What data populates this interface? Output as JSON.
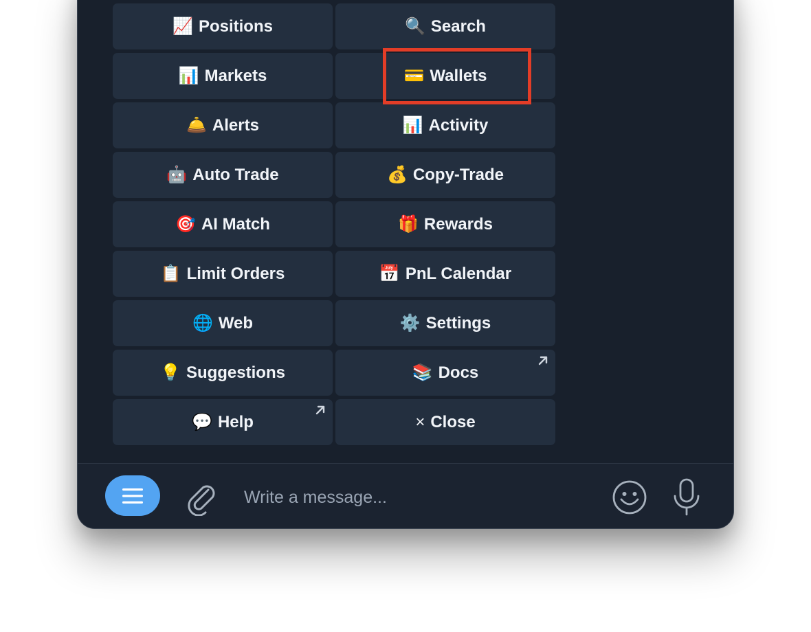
{
  "keyboard": {
    "buttons": [
      {
        "emoji": "📈",
        "label": "Positions"
      },
      {
        "emoji": "🔍",
        "label": "Search"
      },
      {
        "emoji": "📊",
        "label": "Markets"
      },
      {
        "emoji": "💳",
        "label": "Wallets"
      },
      {
        "emoji": "🛎️",
        "label": "Alerts"
      },
      {
        "emoji": "📊",
        "label": "Activity"
      },
      {
        "emoji": "🤖",
        "label": "Auto Trade"
      },
      {
        "emoji": "💰",
        "label": "Copy-Trade"
      },
      {
        "emoji": "🎯",
        "label": "AI Match"
      },
      {
        "emoji": "🎁",
        "label": "Rewards"
      },
      {
        "emoji": "📋",
        "label": "Limit Orders"
      },
      {
        "emoji": "📅",
        "label": "PnL Calendar"
      },
      {
        "emoji": "🌐",
        "label": "Web"
      },
      {
        "emoji": "⚙️",
        "label": "Settings"
      },
      {
        "emoji": "💡",
        "label": "Suggestions"
      },
      {
        "emoji": "📚",
        "label": "Docs"
      },
      {
        "emoji": "💬",
        "label": "Help"
      },
      {
        "emoji": "×",
        "label": "Close"
      }
    ],
    "highlighted_button": "Wallets"
  },
  "composer": {
    "placeholder": "Write a message..."
  },
  "icons": {
    "menu": "menu-lines-icon",
    "attach": "paperclip-icon",
    "emoji": "smiley-icon",
    "mic": "microphone-icon",
    "external_link": "arrow-up-right-icon"
  },
  "colors": {
    "background": "#18202c",
    "button": "#232f3f",
    "accent": "#53a4f2",
    "highlight": "#e33d27"
  }
}
